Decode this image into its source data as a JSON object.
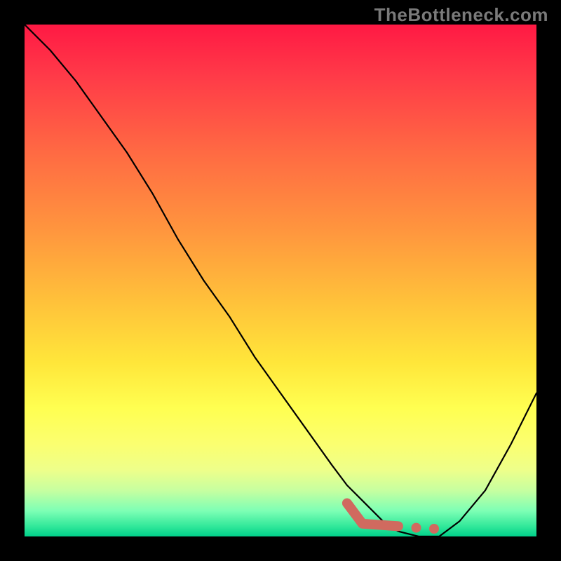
{
  "watermark": "TheBottleneck.com",
  "chart_data": {
    "type": "line",
    "title": "",
    "xlabel": "",
    "ylabel": "",
    "xlim": [
      0,
      100
    ],
    "ylim": [
      0,
      100
    ],
    "series": [
      {
        "name": "curve",
        "x": [
          0,
          5,
          10,
          15,
          20,
          25,
          30,
          35,
          40,
          45,
          50,
          55,
          60,
          63,
          67,
          70,
          73,
          77,
          81,
          85,
          90,
          95,
          100
        ],
        "y": [
          100,
          95,
          89,
          82,
          75,
          67,
          58,
          50,
          43,
          35,
          28,
          21,
          14,
          10,
          6,
          3,
          1,
          0,
          0,
          3,
          9,
          18,
          28
        ]
      }
    ],
    "marker": {
      "name": "highlight",
      "segments": [
        {
          "x": [
            63,
            66,
            73
          ],
          "y": [
            6.5,
            2.5,
            2
          ]
        }
      ],
      "dots": [
        {
          "x": 76.5,
          "y": 1.7
        },
        {
          "x": 80.0,
          "y": 1.5
        }
      ]
    },
    "background_gradient": {
      "top": "#ff1944",
      "mid": "#ffe63a",
      "bottom": "#00d08a"
    }
  }
}
